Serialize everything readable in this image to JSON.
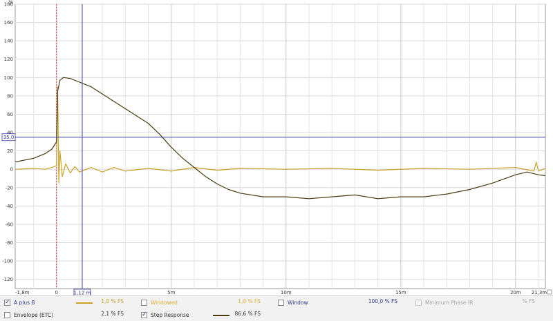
{
  "chart_data": {
    "type": "line",
    "title": "",
    "xlabel": "s",
    "ylabel": "%",
    "xlim": [
      -1.8,
      21.3
    ],
    "ylim": [
      -130,
      180
    ],
    "y_ticks": [
      180,
      160,
      140,
      120,
      100,
      80,
      60,
      40,
      20,
      0,
      -20,
      -40,
      -60,
      -80,
      -100,
      -120
    ],
    "y_tick_labels": [
      "180",
      "160",
      "140",
      "120",
      "100",
      "80",
      "60",
      "40",
      "20",
      "0",
      "-20",
      "-40",
      "-60",
      "-80",
      "-100",
      "-120"
    ],
    "x_tick_labels": [
      {
        "v": -1.8,
        "t": "-1,8m"
      },
      {
        "v": 0,
        "t": "0"
      },
      {
        "v": 5,
        "t": "5m"
      },
      {
        "v": 10,
        "t": "10m"
      },
      {
        "v": 15,
        "t": "15m"
      },
      {
        "v": 20,
        "t": "20m"
      },
      {
        "v": 21.3,
        "t": "21,3m s"
      }
    ],
    "grid": true,
    "cursor_x": {
      "value": 1.12,
      "label": "1,12 m"
    },
    "cursor_y": {
      "value": 35,
      "label": "35,0"
    },
    "marker_x": 0,
    "series": [
      {
        "name": "A plus B",
        "color": "#c9a227",
        "points": [
          [
            -1.8,
            0
          ],
          [
            -1.0,
            1
          ],
          [
            -0.5,
            0
          ],
          [
            -0.2,
            2
          ],
          [
            0,
            4
          ],
          [
            0.05,
            90
          ],
          [
            0.1,
            -15
          ],
          [
            0.15,
            20
          ],
          [
            0.25,
            -8
          ],
          [
            0.4,
            6
          ],
          [
            0.6,
            -4
          ],
          [
            0.8,
            3
          ],
          [
            1.0,
            -3
          ],
          [
            1.5,
            2
          ],
          [
            2.0,
            -3
          ],
          [
            2.5,
            2
          ],
          [
            3.0,
            -2
          ],
          [
            4.0,
            1
          ],
          [
            5.0,
            -2
          ],
          [
            6.0,
            2
          ],
          [
            7.0,
            -1
          ],
          [
            8.0,
            1
          ],
          [
            10.0,
            0
          ],
          [
            12.0,
            1
          ],
          [
            14.0,
            -1
          ],
          [
            16.0,
            1
          ],
          [
            18.0,
            0
          ],
          [
            20.0,
            2
          ],
          [
            20.8,
            -2
          ],
          [
            20.9,
            8
          ],
          [
            21.0,
            -2
          ],
          [
            21.3,
            1
          ]
        ]
      },
      {
        "name": "Step Response",
        "color": "#4a3a10",
        "points": [
          [
            -1.8,
            8
          ],
          [
            -1.0,
            12
          ],
          [
            -0.5,
            17
          ],
          [
            -0.2,
            22
          ],
          [
            0,
            30
          ],
          [
            0.05,
            85
          ],
          [
            0.15,
            97
          ],
          [
            0.3,
            100
          ],
          [
            0.6,
            99
          ],
          [
            1.0,
            95
          ],
          [
            1.5,
            90
          ],
          [
            2.0,
            82
          ],
          [
            3.0,
            66
          ],
          [
            4.0,
            50
          ],
          [
            4.5,
            38
          ],
          [
            5.0,
            24
          ],
          [
            5.5,
            12
          ],
          [
            6.0,
            2
          ],
          [
            6.5,
            -8
          ],
          [
            7.0,
            -16
          ],
          [
            7.5,
            -22
          ],
          [
            8.0,
            -26
          ],
          [
            9.0,
            -30
          ],
          [
            10.0,
            -30
          ],
          [
            11.0,
            -32
          ],
          [
            12.0,
            -30
          ],
          [
            13.0,
            -28
          ],
          [
            14.0,
            -32
          ],
          [
            15.0,
            -30
          ],
          [
            16.0,
            -30
          ],
          [
            17.0,
            -27
          ],
          [
            18.0,
            -22
          ],
          [
            19.0,
            -15
          ],
          [
            20.0,
            -6
          ],
          [
            20.5,
            -3
          ],
          [
            21.0,
            -6
          ],
          [
            21.3,
            -7
          ]
        ]
      }
    ]
  },
  "legend": {
    "row1": [
      {
        "label": "A plus B",
        "checked": true,
        "label_color": "#2b3a8c",
        "swatch": "#c9a227",
        "value": "1,0 % FS",
        "value_color": "#c9a227"
      },
      {
        "label": "Windowed",
        "checked": false,
        "label_color": "#e0b030",
        "swatch": "",
        "value": "1,0 % FS",
        "value_color": "#e0b030"
      },
      {
        "label": "Window",
        "checked": false,
        "label_color": "#2b3a8c",
        "swatch": "",
        "value": "100,0 % FS",
        "value_color": "#2b3a8c"
      },
      {
        "label": "Minimum Phase IR",
        "checked": false,
        "disabled": true,
        "label_color": "#a8a8a8",
        "swatch": "",
        "value": "% FS",
        "value_color": "#a8a8a8"
      }
    ],
    "row2": [
      {
        "label": "Envelope (ETC)",
        "checked": false,
        "label_color": "#333333",
        "swatch": "",
        "value": "2,1 % FS",
        "value_color": "#333333"
      },
      {
        "label": "Step Response",
        "checked": true,
        "label_color": "#333333",
        "swatch": "#4a3a10",
        "value": "86,6 % FS",
        "value_color": "#333333"
      }
    ]
  }
}
